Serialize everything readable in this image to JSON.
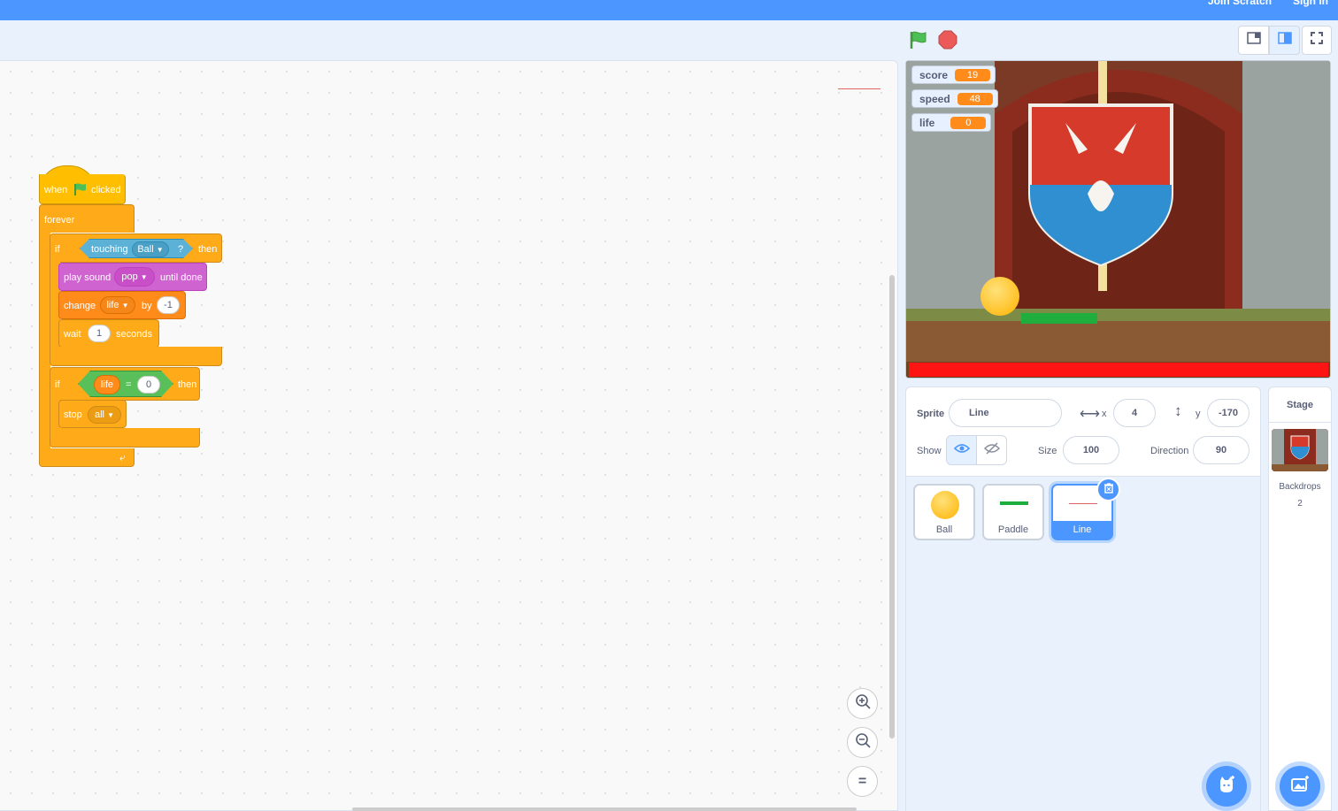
{
  "menubar": {
    "join_label": "Join Scratch",
    "signin_label": "Sign in"
  },
  "code": {
    "hat": {
      "when": "when",
      "clicked": "clicked"
    },
    "forever": "forever",
    "if1": {
      "if": "if",
      "touching": "touching",
      "target": "Ball",
      "q": "?",
      "then": "then"
    },
    "play_sound": {
      "label": "play sound",
      "sound": "pop",
      "until": "until done"
    },
    "change": {
      "label": "change",
      "var": "life",
      "by": "by",
      "value": "-1"
    },
    "wait": {
      "label": "wait",
      "value": "1",
      "unit": "seconds"
    },
    "if2": {
      "if": "if",
      "var": "life",
      "op": "=",
      "value": "0",
      "then": "then"
    },
    "stop": {
      "label": "stop",
      "option": "all"
    }
  },
  "zoom": {
    "reset_label": "="
  },
  "stage": {
    "monitors": [
      {
        "name": "score",
        "value": "19"
      },
      {
        "name": "speed",
        "value": "48"
      },
      {
        "name": "life",
        "value": "0"
      }
    ]
  },
  "sprite_info": {
    "sprite_label": "Sprite",
    "sprite_name": "Line",
    "x_label": "x",
    "x_value": "4",
    "y_label": "y",
    "y_value": "-170",
    "show_label": "Show",
    "size_label": "Size",
    "size_value": "100",
    "direction_label": "Direction",
    "direction_value": "90"
  },
  "sprites": [
    {
      "name": "Ball",
      "selected": false
    },
    {
      "name": "Paddle",
      "selected": false
    },
    {
      "name": "Line",
      "selected": true
    }
  ],
  "stage_selector": {
    "title": "Stage",
    "backdrops_label": "Backdrops",
    "backdrops_count": "2"
  },
  "colors": {
    "accent": "#4c97ff",
    "events": "#ffbf00",
    "control": "#ffab19",
    "sensing": "#5cb1d6",
    "sound": "#cf63cf",
    "variables": "#ff8c1a",
    "operators": "#59c059"
  }
}
